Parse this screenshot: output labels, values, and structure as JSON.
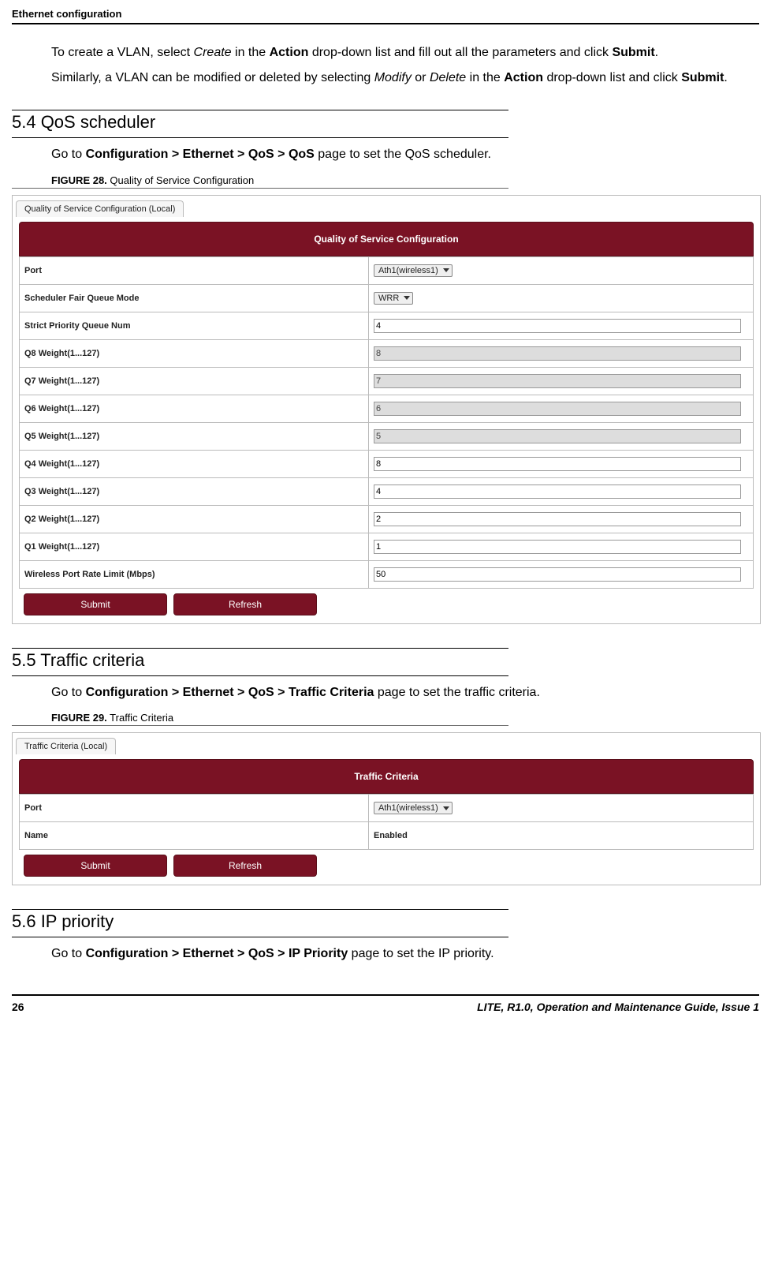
{
  "header": {
    "title": "Ethernet configuration"
  },
  "intro": {
    "p1_prefix": "To create a VLAN, select ",
    "p1_italic1": "Create",
    "p1_mid1": " in the ",
    "p1_bold1": "Action",
    "p1_mid2": " drop-down list and fill out all the parameters and click ",
    "p1_bold2": "Submit",
    "p1_end": ".",
    "p2_prefix": "Similarly, a VLAN can be modified or deleted by selecting ",
    "p2_italic1": "Modify",
    "p2_mid1": " or ",
    "p2_italic2": "Delete",
    "p2_mid2": " in the ",
    "p2_bold1": "Action",
    "p2_mid3": " drop-down list and click ",
    "p2_bold2": "Submit",
    "p2_end": "."
  },
  "s54": {
    "heading": "5.4 QoS scheduler",
    "body_pre": "Go to ",
    "body_bold": "Configuration > Ethernet > QoS > QoS",
    "body_post": " page to set the QoS scheduler.",
    "figcap_bold": "FIGURE 28.",
    "figcap_rest": " Quality of Service Configuration"
  },
  "qos": {
    "tab": "Quality of Service Configuration (Local)",
    "banner": "Quality of Service Configuration",
    "rows": {
      "port_label": "Port",
      "port_value": "Ath1(wireless1)",
      "sched_label": "Scheduler Fair Queue Mode",
      "sched_value": "WRR",
      "strict_label": "Strict Priority Queue Num",
      "strict_value": "4",
      "q8_label": "Q8 Weight(1...127)",
      "q8_value": "8",
      "q7_label": "Q7 Weight(1...127)",
      "q7_value": "7",
      "q6_label": "Q6 Weight(1...127)",
      "q6_value": "6",
      "q5_label": "Q5 Weight(1...127)",
      "q5_value": "5",
      "q4_label": "Q4 Weight(1...127)",
      "q4_value": "8",
      "q3_label": "Q3 Weight(1...127)",
      "q3_value": "4",
      "q2_label": "Q2 Weight(1...127)",
      "q2_value": "2",
      "q1_label": "Q1 Weight(1...127)",
      "q1_value": "1",
      "rate_label": "Wireless Port Rate Limit (Mbps)",
      "rate_value": "50"
    },
    "buttons": {
      "submit": "Submit",
      "refresh": "Refresh"
    }
  },
  "s55": {
    "heading": "5.5 Traffic criteria",
    "body_pre": "Go to ",
    "body_bold": "Configuration > Ethernet > QoS > Traffic Criteria",
    "body_post": " page to set the traffic criteria.",
    "figcap_bold": "FIGURE 29.",
    "figcap_rest": " Traffic Criteria"
  },
  "tc": {
    "tab": "Traffic Criteria (Local)",
    "banner": "Traffic Criteria",
    "rows": {
      "port_label": "Port",
      "port_value": "Ath1(wireless1)",
      "name_label": "Name",
      "name_value": "Enabled"
    },
    "buttons": {
      "submit": "Submit",
      "refresh": "Refresh"
    }
  },
  "s56": {
    "heading": "5.6 IP priority",
    "body_pre": "Go to ",
    "body_bold": "Configuration > Ethernet > QoS > IP Priority",
    "body_post": " page to set the IP priority."
  },
  "footer": {
    "page": "26",
    "right": "LITE, R1.0, Operation and Maintenance Guide, Issue 1"
  }
}
